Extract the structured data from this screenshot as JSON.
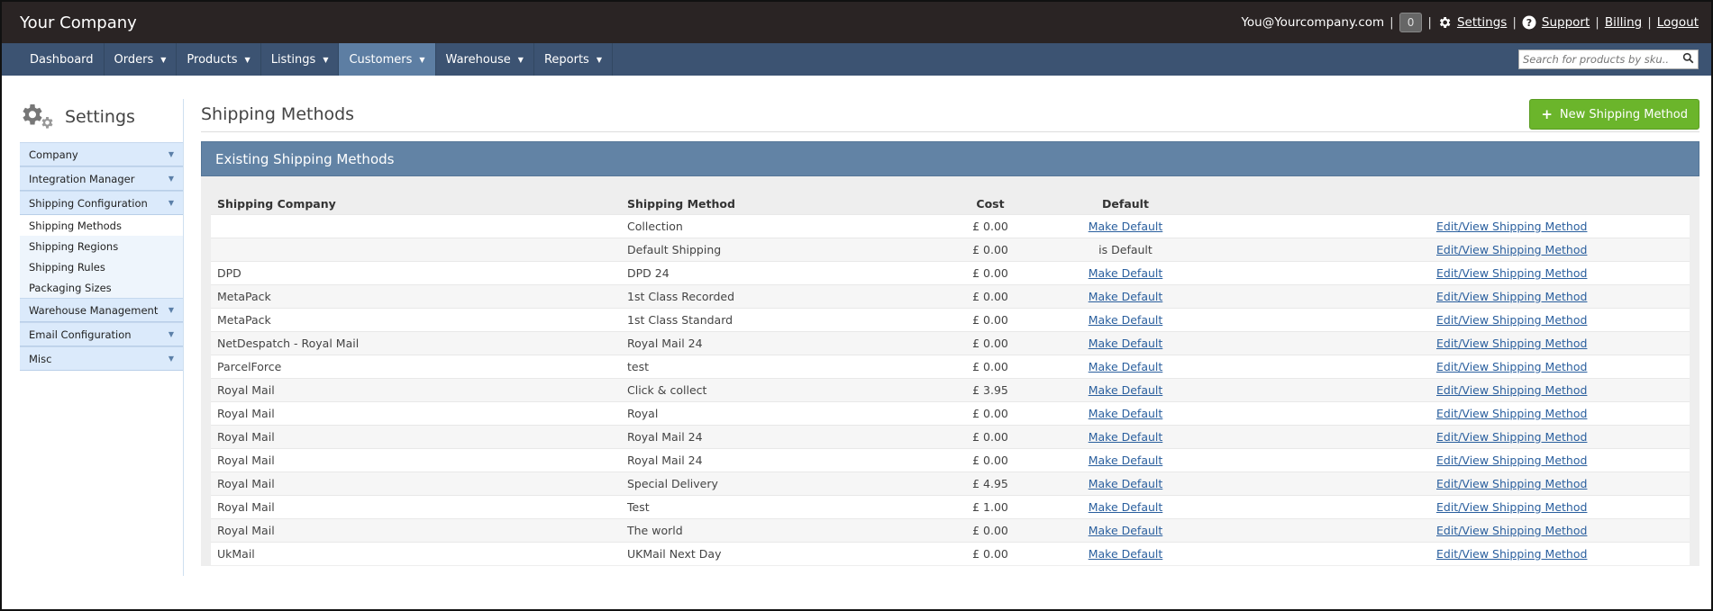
{
  "topbar": {
    "brand": "Your Company",
    "email": "You@Yourcompany.com",
    "notifications": "0",
    "settings": "Settings",
    "support": "Support",
    "billing": "Billing",
    "logout": "Logout",
    "separator": "|"
  },
  "nav": {
    "items": [
      {
        "label": "Dashboard"
      },
      {
        "label": "Orders"
      },
      {
        "label": "Products"
      },
      {
        "label": "Listings"
      },
      {
        "label": "Customers"
      },
      {
        "label": "Warehouse"
      },
      {
        "label": "Reports"
      }
    ],
    "search_placeholder": "Search for products by sku.."
  },
  "sidebar": {
    "title": "Settings",
    "sections": {
      "company": "Company",
      "integration": "Integration Manager",
      "shipping_config": "Shipping Configuration",
      "shipping_sub": [
        "Shipping Methods",
        "Shipping Regions",
        "Shipping Rules",
        "Packaging Sizes"
      ],
      "warehouse": "Warehouse Management",
      "email": "Email Configuration",
      "misc": "Misc"
    }
  },
  "main": {
    "title": "Shipping Methods",
    "new_button": "New Shipping Method",
    "panel_title": "Existing Shipping Methods",
    "columns": {
      "company": "Shipping Company",
      "method": "Shipping Method",
      "cost": "Cost",
      "default": "Default"
    },
    "rows": [
      {
        "company": "",
        "method": "Collection",
        "cost": "£ 0.00",
        "default": "Make Default",
        "edit": "Edit/View Shipping Method"
      },
      {
        "company": "",
        "method": "Default Shipping",
        "cost": "£ 0.00",
        "default": "is Default",
        "edit": "Edit/View Shipping Method"
      },
      {
        "company": "DPD",
        "method": "DPD 24",
        "cost": "£ 0.00",
        "default": "Make Default",
        "edit": "Edit/View Shipping Method"
      },
      {
        "company": "MetaPack",
        "method": "1st Class Recorded",
        "cost": "£ 0.00",
        "default": "Make Default",
        "edit": "Edit/View Shipping Method"
      },
      {
        "company": "MetaPack",
        "method": "1st Class Standard",
        "cost": "£ 0.00",
        "default": "Make Default",
        "edit": "Edit/View Shipping Method"
      },
      {
        "company": "NetDespatch - Royal Mail",
        "method": "Royal Mail 24",
        "cost": "£ 0.00",
        "default": "Make Default",
        "edit": "Edit/View Shipping Method"
      },
      {
        "company": "ParcelForce",
        "method": "test",
        "cost": "£ 0.00",
        "default": "Make Default",
        "edit": "Edit/View Shipping Method"
      },
      {
        "company": "Royal Mail",
        "method": "Click & collect",
        "cost": "£ 3.95",
        "default": "Make Default",
        "edit": "Edit/View Shipping Method"
      },
      {
        "company": "Royal Mail",
        "method": "Royal",
        "cost": "£ 0.00",
        "default": "Make Default",
        "edit": "Edit/View Shipping Method"
      },
      {
        "company": "Royal Mail",
        "method": "Royal Mail 24",
        "cost": "£ 0.00",
        "default": "Make Default",
        "edit": "Edit/View Shipping Method"
      },
      {
        "company": "Royal Mail",
        "method": "Royal Mail 24",
        "cost": "£ 0.00",
        "default": "Make Default",
        "edit": "Edit/View Shipping Method"
      },
      {
        "company": "Royal Mail",
        "method": "Special Delivery",
        "cost": "£ 4.95",
        "default": "Make Default",
        "edit": "Edit/View Shipping Method"
      },
      {
        "company": "Royal Mail",
        "method": "Test",
        "cost": "£ 1.00",
        "default": "Make Default",
        "edit": "Edit/View Shipping Method"
      },
      {
        "company": "Royal Mail",
        "method": "The world",
        "cost": "£ 0.00",
        "default": "Make Default",
        "edit": "Edit/View Shipping Method"
      },
      {
        "company": "UkMail",
        "method": "UKMail Next Day",
        "cost": "£ 0.00",
        "default": "Make Default",
        "edit": "Edit/View Shipping Method"
      }
    ]
  },
  "icons": {
    "settings_gear": "gear-icon",
    "support": "question-circle-icon",
    "search": "search-icon",
    "caret": "caret-down-icon",
    "plus": "plus-icon"
  },
  "colors": {
    "topbar": "#2a2424",
    "navbar": "#3c5372",
    "nav_active": "#5d7ea3",
    "panel_head": "#6283a5",
    "primary_button": "#6bb52b",
    "link": "#2a5f9e",
    "sidebar_section": "#dbeafb"
  }
}
